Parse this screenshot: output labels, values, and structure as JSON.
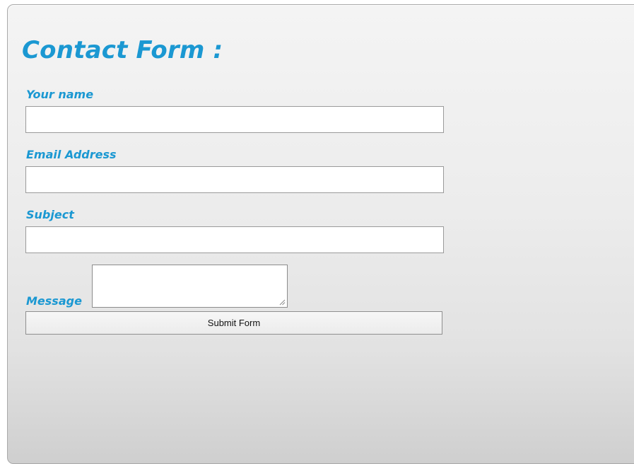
{
  "form": {
    "title": "Contact Form :",
    "fields": {
      "name": {
        "label": "Your name",
        "value": ""
      },
      "email": {
        "label": "Email Address",
        "value": ""
      },
      "subject": {
        "label": "Subject",
        "value": ""
      },
      "message": {
        "label": "Message",
        "value": ""
      }
    },
    "submit_label": "Submit Form"
  },
  "colors": {
    "accent": "#1b98d2",
    "panel_top": "#f4f4f4",
    "panel_bottom": "#cfcfcf",
    "field_border": "#9a9a9a"
  },
  "icons": {
    "textarea_resize": "resize-grip-icon"
  }
}
